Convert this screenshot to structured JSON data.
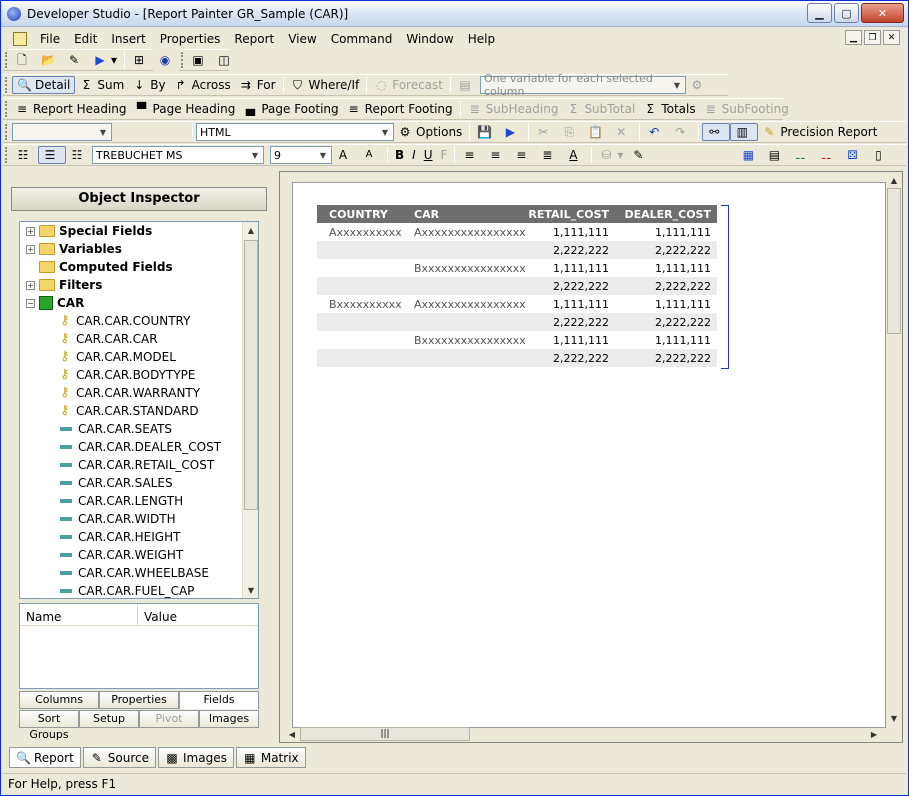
{
  "window": {
    "title": "Developer Studio - [Report Painter GR_Sample (CAR)]"
  },
  "menu": [
    "File",
    "Edit",
    "Insert",
    "Properties",
    "Report",
    "View",
    "Command",
    "Window",
    "Help"
  ],
  "toolbar1": {
    "run_arrow": "▶"
  },
  "toolbar2": {
    "detail": "Detail",
    "sum": "Sum",
    "by": "By",
    "across": "Across",
    "for": "For",
    "whereif": "Where/If",
    "forecast": "Forecast",
    "variable_combo": "One variable for each selected column"
  },
  "toolbar3": {
    "report_heading": "Report Heading",
    "page_heading": "Page Heading",
    "page_footing": "Page Footing",
    "report_footing": "Report Footing",
    "subheading": "SubHeading",
    "subtotal": "SubTotal",
    "totals": "Totals",
    "subfooting": "SubFooting"
  },
  "toolbar4": {
    "empty_combo": "",
    "format_combo": "HTML",
    "options": "Options",
    "precision_report": "Precision Report"
  },
  "toolbar5": {
    "font": "TREBUCHET MS",
    "size": "9",
    "bold": "B",
    "italic": "I",
    "underline": "U",
    "f": "F"
  },
  "inspector": {
    "title": "Object Inspector",
    "tree": [
      {
        "label": "Special Fields",
        "kind": "folder",
        "bold": true,
        "exp": "+"
      },
      {
        "label": "Variables",
        "kind": "folder",
        "bold": true,
        "exp": "+"
      },
      {
        "label": "Computed Fields",
        "kind": "folder",
        "bold": true,
        "exp": ""
      },
      {
        "label": "Filters",
        "kind": "folder",
        "bold": true,
        "exp": "+"
      },
      {
        "label": "CAR",
        "kind": "cube",
        "bold": true,
        "exp": "−"
      },
      {
        "label": "CAR.CAR.COUNTRY",
        "kind": "key"
      },
      {
        "label": "CAR.CAR.CAR",
        "kind": "key"
      },
      {
        "label": "CAR.CAR.MODEL",
        "kind": "key"
      },
      {
        "label": "CAR.CAR.BODYTYPE",
        "kind": "key"
      },
      {
        "label": "CAR.CAR.WARRANTY",
        "kind": "key"
      },
      {
        "label": "CAR.CAR.STANDARD",
        "kind": "key"
      },
      {
        "label": "CAR.CAR.SEATS",
        "kind": "field"
      },
      {
        "label": "CAR.CAR.DEALER_COST",
        "kind": "field"
      },
      {
        "label": "CAR.CAR.RETAIL_COST",
        "kind": "field"
      },
      {
        "label": "CAR.CAR.SALES",
        "kind": "field"
      },
      {
        "label": "CAR.CAR.LENGTH",
        "kind": "field"
      },
      {
        "label": "CAR.CAR.WIDTH",
        "kind": "field"
      },
      {
        "label": "CAR.CAR.HEIGHT",
        "kind": "field"
      },
      {
        "label": "CAR.CAR.WEIGHT",
        "kind": "field"
      },
      {
        "label": "CAR.CAR.WHEELBASE",
        "kind": "field"
      },
      {
        "label": "CAR.CAR.FUEL_CAP",
        "kind": "field"
      }
    ],
    "props_head": {
      "name": "Name",
      "value": "Value"
    },
    "tabs_row1": [
      "Columns",
      "Properties",
      "Fields"
    ],
    "tabs_row2": [
      "Sort Groups",
      "Setup",
      "Pivot",
      "Images"
    ]
  },
  "report": {
    "headers": [
      "COUNTRY",
      "CAR",
      "RETAIL_COST",
      "DEALER_COST"
    ],
    "rows": [
      [
        "Axxxxxxxxxx",
        "Axxxxxxxxxxxxxxxx",
        "1,111,111",
        "1,111,111"
      ],
      [
        "",
        "",
        "2,222,222",
        "2,222,222"
      ],
      [
        "",
        "Bxxxxxxxxxxxxxxxx",
        "1,111,111",
        "1,111,111"
      ],
      [
        "",
        "",
        "2,222,222",
        "2,222,222"
      ],
      [
        "Bxxxxxxxxxx",
        "Axxxxxxxxxxxxxxxx",
        "1,111,111",
        "1,111,111"
      ],
      [
        "",
        "",
        "2,222,222",
        "2,222,222"
      ],
      [
        "",
        "Bxxxxxxxxxxxxxxxx",
        "1,111,111",
        "1,111,111"
      ],
      [
        "",
        "",
        "2,222,222",
        "2,222,222"
      ]
    ]
  },
  "bottom_tabs": [
    "Report",
    "Source",
    "Images",
    "Matrix"
  ],
  "status": "For Help, press F1"
}
